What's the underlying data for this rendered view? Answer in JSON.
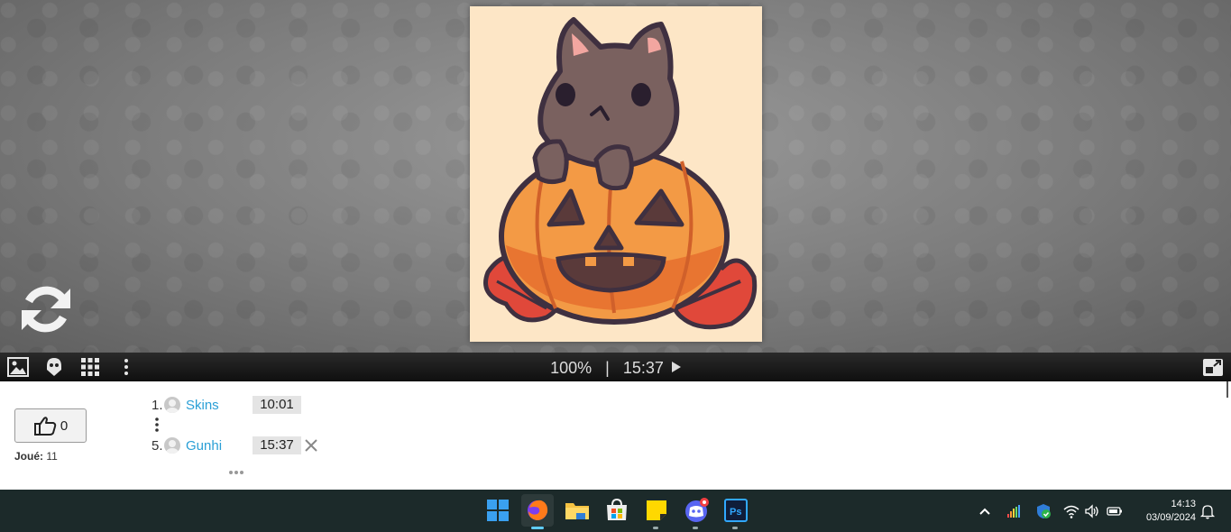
{
  "viewer": {
    "zoom": "100%",
    "separator": "|",
    "time": "15:37"
  },
  "likes": {
    "count": "0"
  },
  "played": {
    "label": "Joué:",
    "count": "11"
  },
  "scores": [
    {
      "rank": "1.",
      "name": "Skins",
      "time": "10:01"
    },
    {
      "rank": "5.",
      "name": "Gunhi",
      "time": "15:37"
    }
  ],
  "taskbar": {
    "apps": [
      "windows-start",
      "firefox",
      "file-explorer",
      "microsoft-store",
      "sticky-notes",
      "discord",
      "photoshop"
    ],
    "photoshop_label": "Ps",
    "clock_time": "14:13",
    "clock_date": "03/09/2024"
  },
  "colors": {
    "link": "#2a9fd6",
    "toolbar": "#1a1a1a",
    "taskbar": "#1c2a2a",
    "pumpkin": "#f39a45",
    "cat": "#7a615f"
  }
}
